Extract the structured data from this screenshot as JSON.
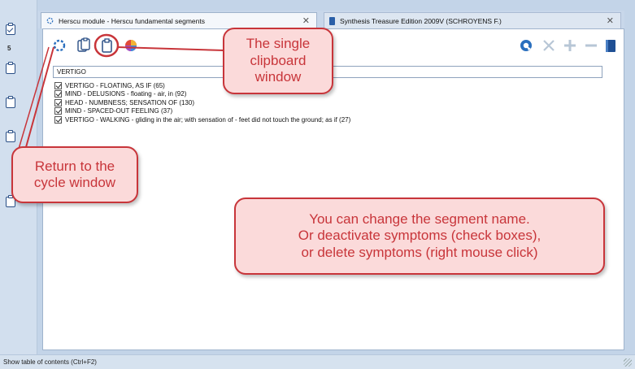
{
  "clipboard_strip": {
    "count": "5"
  },
  "tabs": [
    {
      "label": "Herscu module - Herscu fundamental segments",
      "close": "✕"
    },
    {
      "label": "Synthesis Treasure Edition 2009V (SCHROYENS F.)",
      "close": "✕"
    }
  ],
  "segment": {
    "name": "VERTIGO"
  },
  "symptoms": [
    "VERTIGO - FLOATING, AS IF (65)",
    "MIND - DELUSIONS - floating - air, in (92)",
    "HEAD - NUMBNESS; SENSATION OF (130)",
    "MIND - SPACED-OUT FEELING (37)",
    "VERTIGO - WALKING - gliding in the air; with sensation of - feet did not touch the ground; as if (27)"
  ],
  "status": "Show table of contents (Ctrl+F2)",
  "annotations": {
    "clipboard": [
      "The single",
      "clipboard",
      "window"
    ],
    "cycle": [
      "Return to the",
      "cycle window"
    ],
    "info": [
      "You can change the segment name.",
      "Or deactivate symptoms (check boxes),",
      "or delete symptoms (right mouse click)"
    ]
  },
  "colors": {
    "annotation_red": "#c8353a",
    "annotation_fill": "#fbdada",
    "toolbar_blue": "#2a6fbe"
  },
  "icons": [
    "cycle-icon",
    "clipboards-icon",
    "clipboard-icon",
    "color-wheel-icon",
    "refresh-icon",
    "delete-x-icon",
    "plus-icon",
    "minus-icon",
    "book-icon"
  ]
}
